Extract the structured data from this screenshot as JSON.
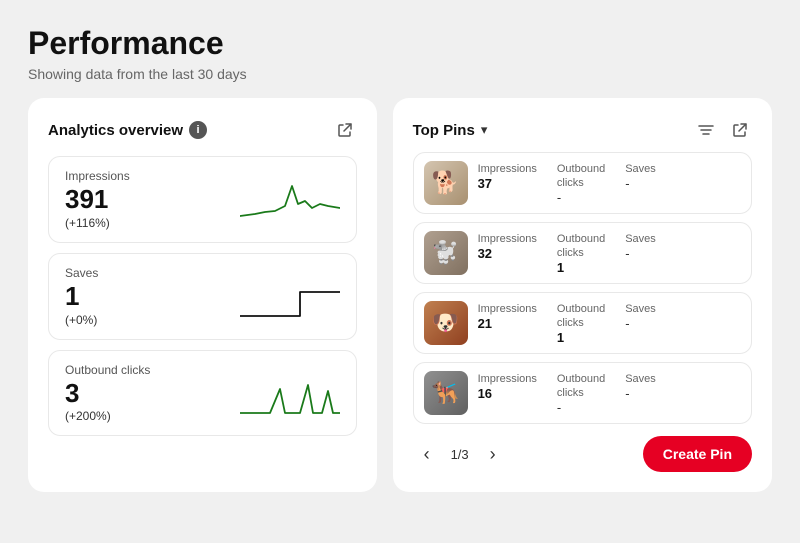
{
  "page": {
    "title": "Performance",
    "subtitle": "Showing data from the last 30 days"
  },
  "analytics": {
    "panel_title": "Analytics overview",
    "info_icon_label": "i",
    "external_link_icon": "↗",
    "metrics": [
      {
        "label": "Impressions",
        "value": "391",
        "change": "(+116%)",
        "chart_id": "impressions"
      },
      {
        "label": "Saves",
        "value": "1",
        "change": "(+0%)",
        "chart_id": "saves"
      },
      {
        "label": "Outbound clicks",
        "value": "3",
        "change": "(+200%)",
        "chart_id": "outbound"
      }
    ]
  },
  "top_pins": {
    "panel_title": "Top Pins",
    "chevron_icon": "∨",
    "filter_icon": "⚙",
    "export_icon": "↗",
    "pins": [
      {
        "thumb_emoji": "🐕",
        "thumb_class": "dog-thumb-1",
        "impressions_label": "Impressions",
        "impressions_value": "37",
        "outbound_label": "Outbound clicks",
        "outbound_value": "-",
        "saves_label": "Saves",
        "saves_value": "-"
      },
      {
        "thumb_emoji": "🐩",
        "thumb_class": "dog-thumb-2",
        "impressions_label": "Impressions",
        "impressions_value": "32",
        "outbound_label": "Outbound clicks",
        "outbound_value": "1",
        "saves_label": "Saves",
        "saves_value": "-"
      },
      {
        "thumb_emoji": "🐶",
        "thumb_class": "dog-thumb-3",
        "impressions_label": "Impressions",
        "impressions_value": "21",
        "outbound_label": "Outbound clicks",
        "outbound_value": "1",
        "saves_label": "Saves",
        "saves_value": "-"
      },
      {
        "thumb_emoji": "🐕‍🦺",
        "thumb_class": "dog-thumb-4",
        "impressions_label": "Impressions",
        "impressions_value": "16",
        "outbound_label": "Outbound clicks",
        "outbound_value": "-",
        "saves_label": "Saves",
        "saves_value": "-"
      }
    ],
    "pagination": {
      "prev_icon": "‹",
      "next_icon": "›",
      "current": "1/3"
    },
    "create_pin_label": "Create Pin"
  }
}
